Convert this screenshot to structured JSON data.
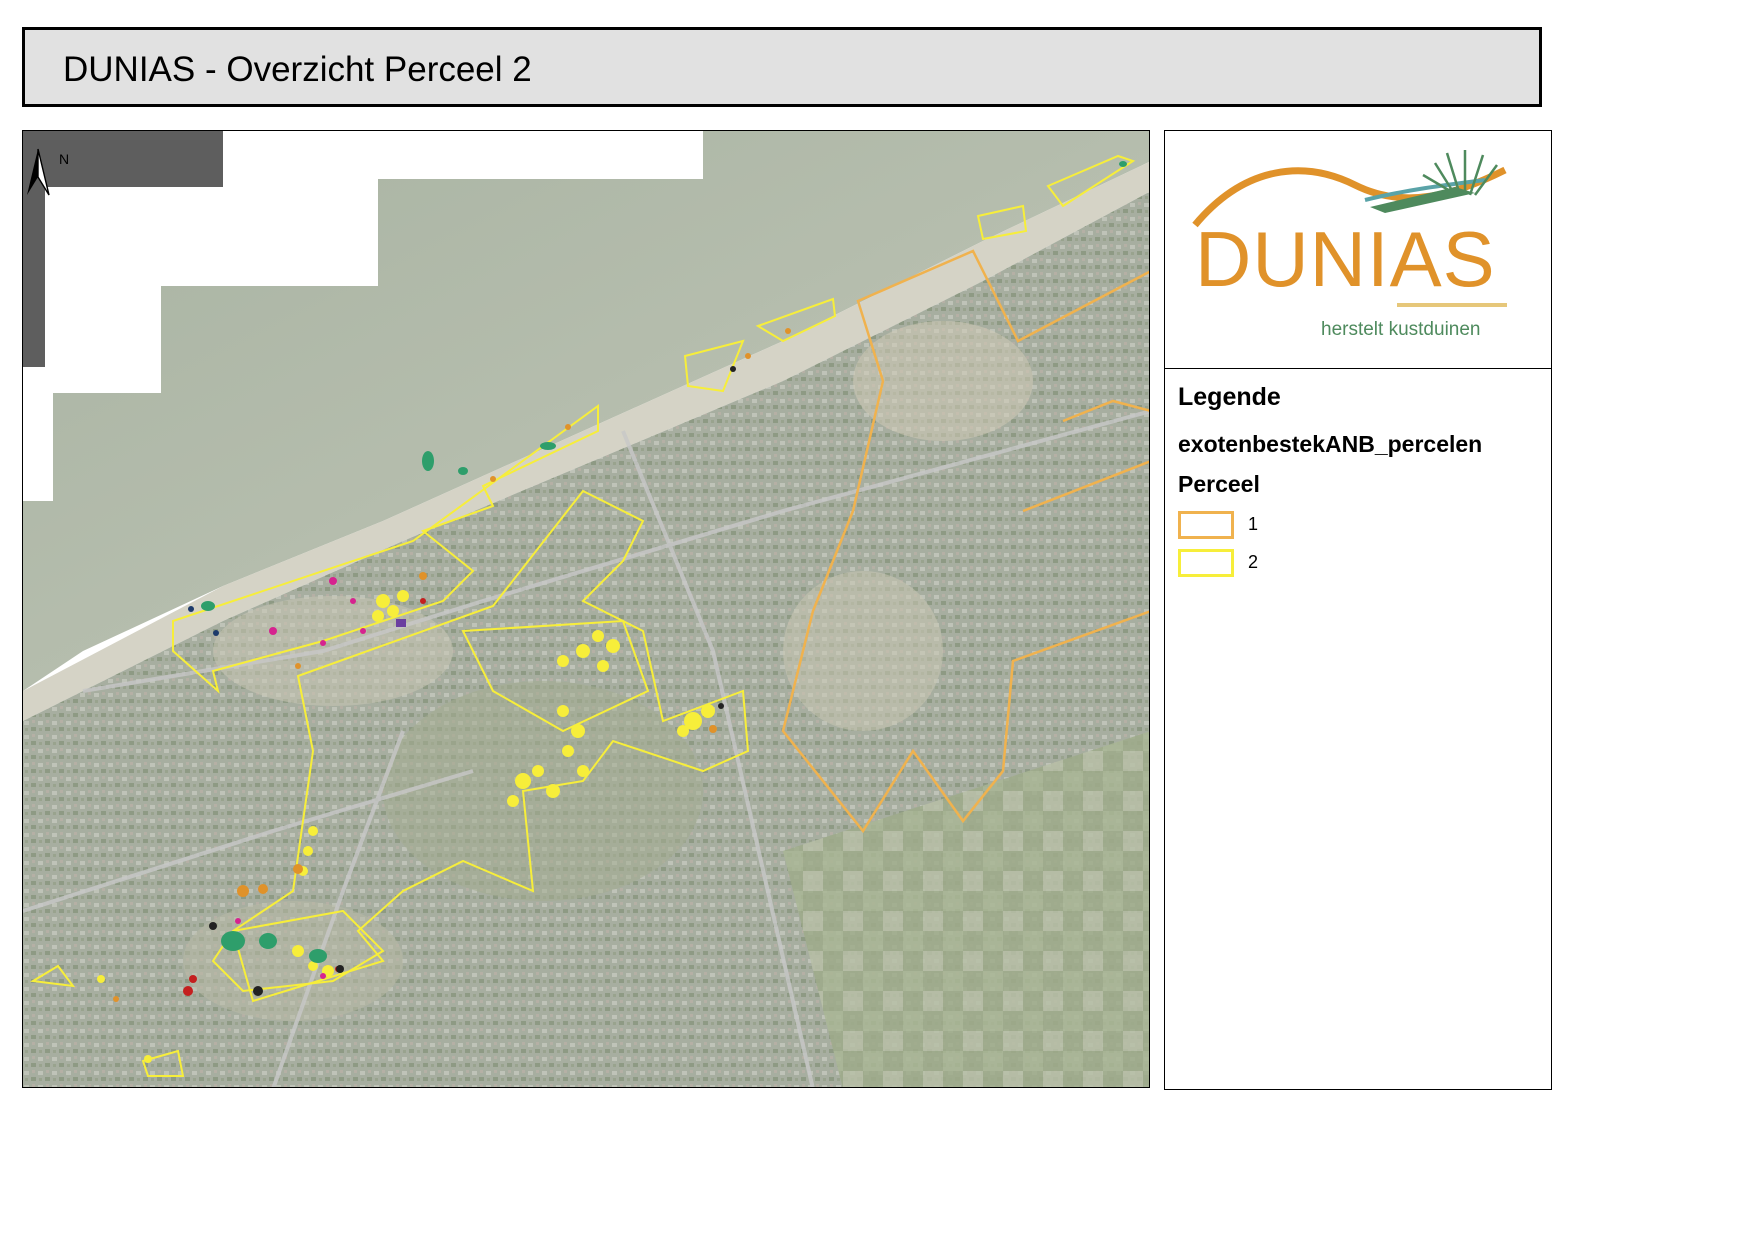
{
  "title": "DUNIAS - Overzicht Perceel 2",
  "map": {
    "north_label": "N",
    "perceel_colors": {
      "1": "#f0b24e",
      "2": "#f7ee3a"
    },
    "point_colors": [
      "#f7ee3a",
      "#2e9e6b",
      "#e0922a",
      "#d6238f",
      "#c41f1f",
      "#222222",
      "#6b3fa0",
      "#1d3a6b"
    ]
  },
  "logo": {
    "wordmark": "DUNIAS",
    "tagline": "herstelt kustduinen",
    "colors": {
      "orange": "#e0922a",
      "green": "#4e8a5d",
      "teal": "#5aa3a8",
      "sand": "#e6c77a"
    }
  },
  "legend": {
    "title": "Legende",
    "layer": "exotenbestekANB_percelen",
    "field": "Perceel",
    "items": [
      {
        "label": "1",
        "color": "#f0b24e"
      },
      {
        "label": "2",
        "color": "#f7ee3a"
      }
    ]
  }
}
